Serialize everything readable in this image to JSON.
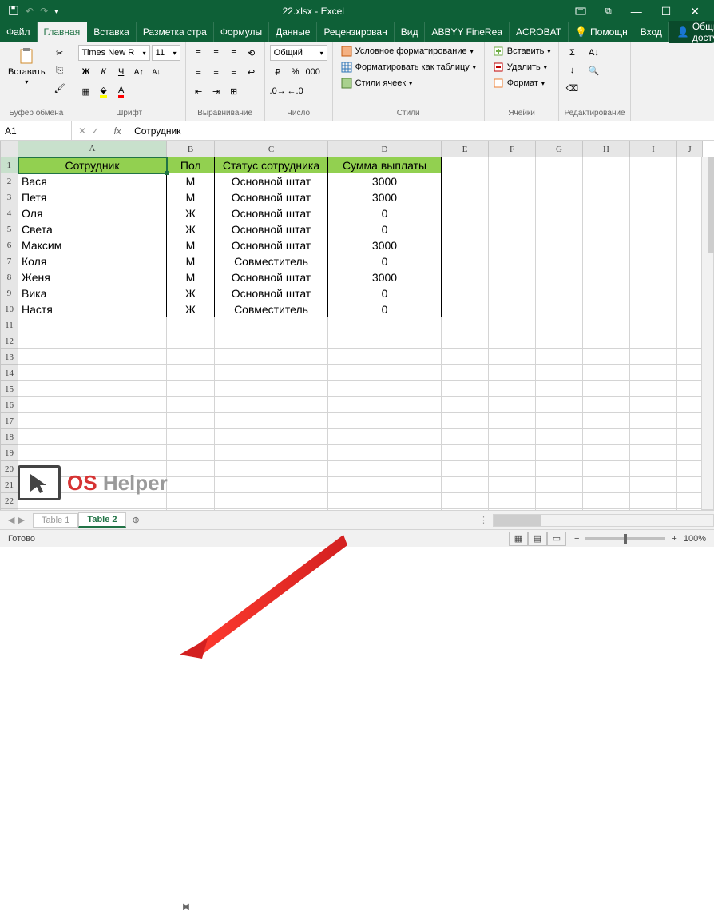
{
  "title": "22.xlsx - Excel",
  "menu": {
    "file": "Файл",
    "home": "Главная",
    "insert": "Вставка",
    "layout": "Разметка стра",
    "formulas": "Формулы",
    "data": "Данные",
    "review": "Рецензирован",
    "view": "Вид",
    "abbyy": "ABBYY FineRea",
    "acrobat": "ACROBAT",
    "help": "Помощн",
    "login": "Вход",
    "share": "Общий доступ"
  },
  "ribbon": {
    "paste": "Вставить",
    "clipboard": "Буфер обмена",
    "font": "Шрифт",
    "font_name": "Times New R",
    "font_size": "11",
    "alignment": "Выравнивание",
    "number": "Число",
    "number_fmt": "Общий",
    "styles": "Стили",
    "cond_fmt": "Условное форматирование",
    "fmt_table": "Форматировать как таблицу",
    "cell_styles": "Стили ячеек",
    "cells": "Ячейки",
    "insert_cell": "Вставить",
    "delete_cell": "Удалить",
    "format_cell": "Формат",
    "editing": "Редактирование"
  },
  "formula_bar": {
    "name": "A1",
    "value": "Сотрудник"
  },
  "columns": [
    "A",
    "B",
    "C",
    "D",
    "E",
    "F",
    "G",
    "H",
    "I",
    "J"
  ],
  "headers": {
    "emp": "Сотрудник",
    "sex": "Пол",
    "status": "Статус сотрудника",
    "sum": "Сумма выплаты"
  },
  "rows": [
    {
      "emp": "Вася",
      "sex": "М",
      "status": "Основной штат",
      "sum": "3000"
    },
    {
      "emp": "Петя",
      "sex": "М",
      "status": "Основной штат",
      "sum": "3000"
    },
    {
      "emp": "Оля",
      "sex": "Ж",
      "status": "Основной штат",
      "sum": "0"
    },
    {
      "emp": "Света",
      "sex": "Ж",
      "status": "Основной штат",
      "sum": "0"
    },
    {
      "emp": "Максим",
      "sex": "М",
      "status": "Основной штат",
      "sum": "3000"
    },
    {
      "emp": "Коля",
      "sex": "М",
      "status": "Совместитель",
      "sum": "0"
    },
    {
      "emp": "Женя",
      "sex": "М",
      "status": "Основной штат",
      "sum": "3000"
    },
    {
      "emp": "Вика",
      "sex": "Ж",
      "status": "Основной штат",
      "sum": "0"
    },
    {
      "emp": "Настя",
      "sex": "Ж",
      "status": "Совместитель",
      "sum": "0"
    }
  ],
  "sheets": {
    "s1": "Table 1",
    "s2": "Table 2"
  },
  "status": {
    "ready": "Готово",
    "zoom": "100%"
  },
  "watermark": {
    "os": "OS",
    "helper": "Helper"
  }
}
